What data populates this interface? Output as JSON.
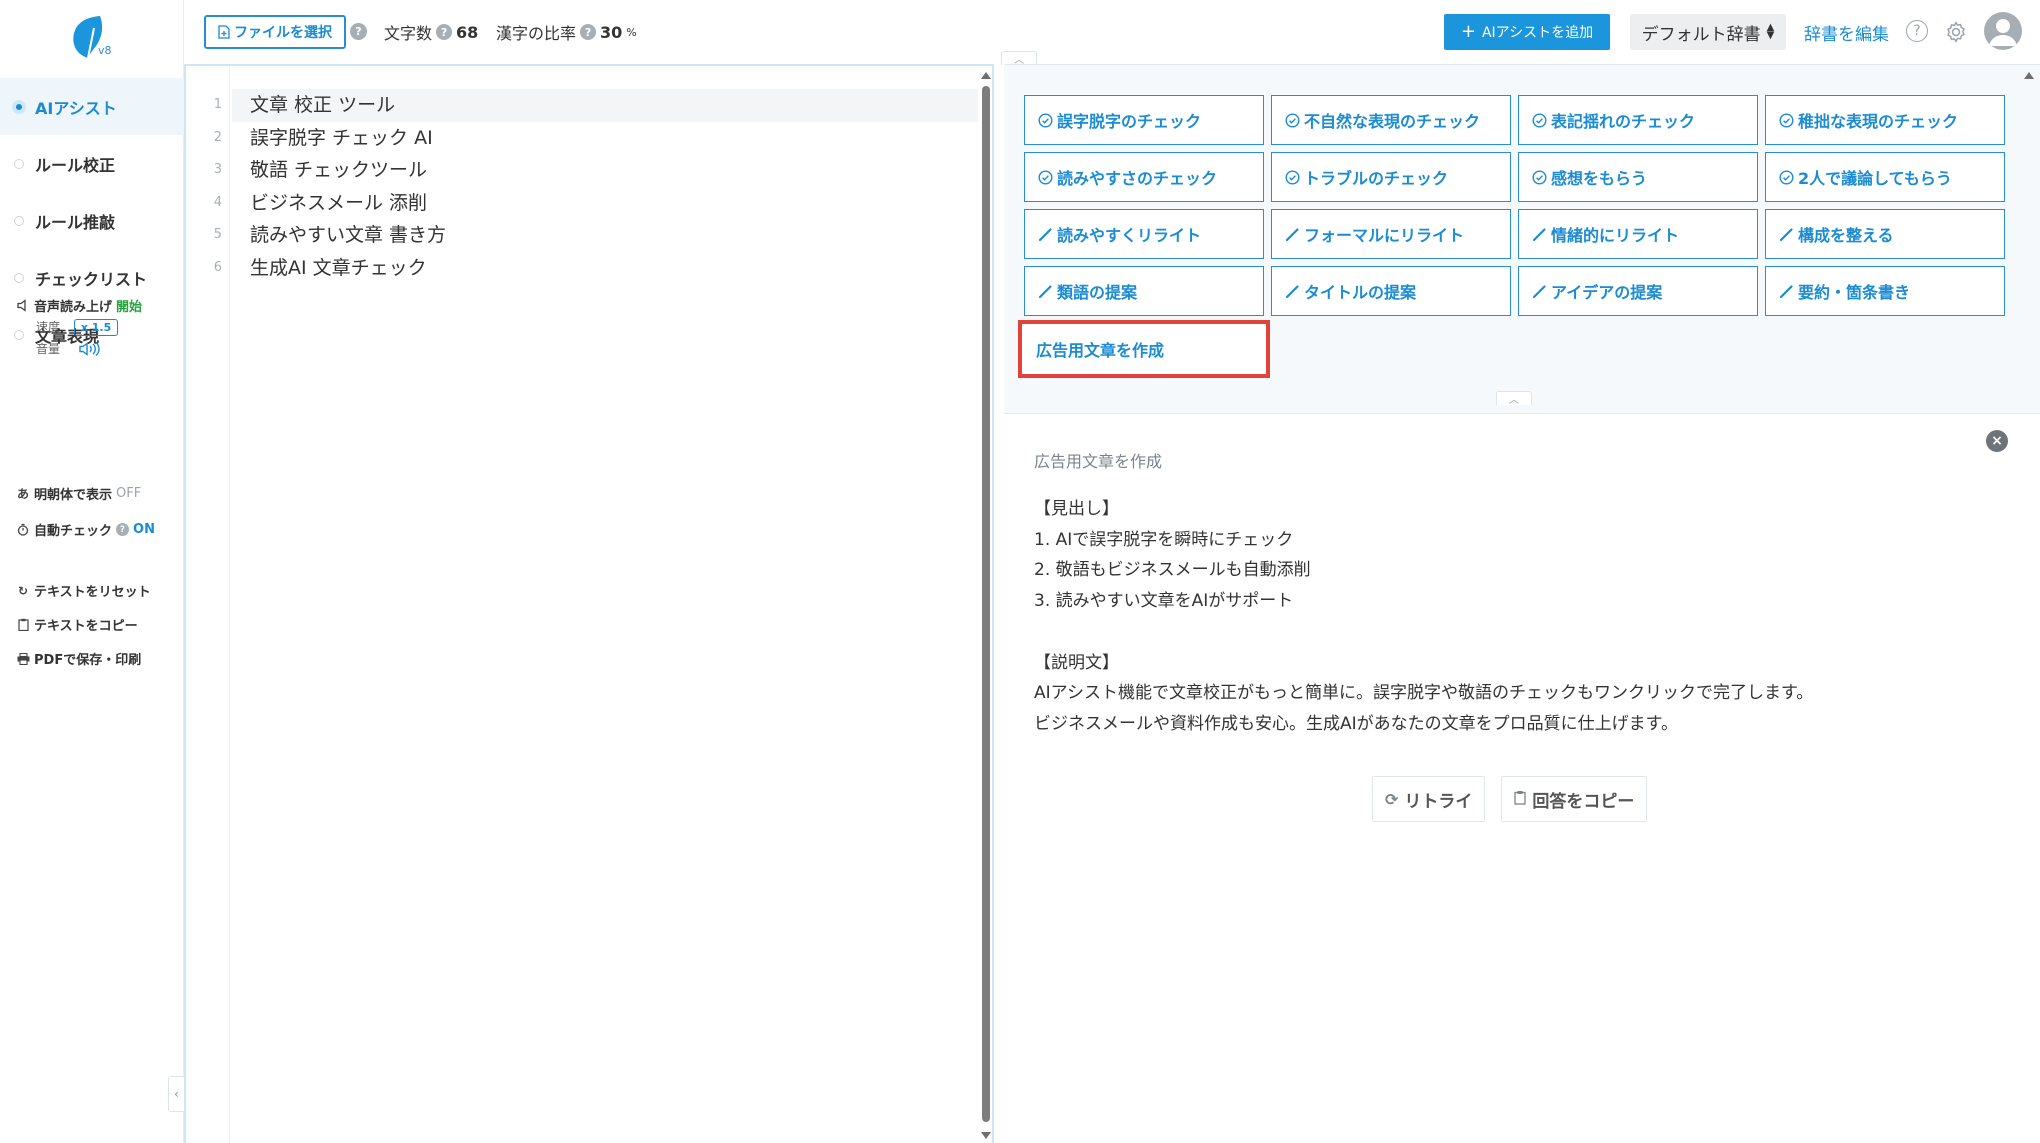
{
  "app": {
    "logo_version": "v8"
  },
  "sidebar": {
    "nav": [
      {
        "label": "AIアシスト",
        "active": true
      },
      {
        "label": "ルール校正",
        "active": false
      },
      {
        "label": "ルール推敲",
        "active": false
      },
      {
        "label": "チェックリスト",
        "active": false
      },
      {
        "label": "文章表現",
        "active": false
      }
    ],
    "voice": {
      "label": "音声読み上げ",
      "action": "開始",
      "speed_label": "速度",
      "speed_value": "x 1.5",
      "volume_label": "音量"
    },
    "mincho": {
      "label": "明朝体で表示",
      "state": "OFF"
    },
    "auto_check": {
      "label": "自動チェック",
      "state": "ON"
    },
    "reset": "テキストをリセット",
    "copy": "テキストをコピー",
    "pdf": "PDFで保存・印刷"
  },
  "topbar": {
    "file_button": "ファイルを選択",
    "char_count_label": "文字数",
    "char_count": "68",
    "kanji_ratio_label": "漢字の比率",
    "kanji_ratio": "30",
    "kanji_ratio_unit": "%",
    "add_ai_button": "AIアシストを追加",
    "dictionary": "デフォルト辞書",
    "edit_dictionary": "辞書を編集"
  },
  "editor": {
    "lines": [
      {
        "num": "1",
        "text": "文章 校正 ツール"
      },
      {
        "num": "2",
        "text": "誤字脱字 チェック AI"
      },
      {
        "num": "3",
        "text": "敬語 チェックツール"
      },
      {
        "num": "4",
        "text": "ビジネスメール 添削"
      },
      {
        "num": "5",
        "text": "読みやすい文章 書き方"
      },
      {
        "num": "6",
        "text": "生成AI 文章チェック"
      }
    ]
  },
  "assist": {
    "buttons": [
      {
        "label": "誤字脱字のチェック",
        "icon": "check-circle"
      },
      {
        "label": "不自然な表現のチェック",
        "icon": "check-circle"
      },
      {
        "label": "表記揺れのチェック",
        "icon": "check-circle"
      },
      {
        "label": "稚拙な表現のチェック",
        "icon": "check-circle"
      },
      {
        "label": "読みやすさのチェック",
        "icon": "check-circle"
      },
      {
        "label": "トラブルのチェック",
        "icon": "check-circle"
      },
      {
        "label": "感想をもらう",
        "icon": "check-circle"
      },
      {
        "label": "2人で議論してもらう",
        "icon": "check-circle"
      },
      {
        "label": "読みやすくリライト",
        "icon": "pencil"
      },
      {
        "label": "フォーマルにリライト",
        "icon": "pencil"
      },
      {
        "label": "情緒的にリライト",
        "icon": "pencil"
      },
      {
        "label": "構成を整える",
        "icon": "pencil"
      },
      {
        "label": "類語の提案",
        "icon": "pencil"
      },
      {
        "label": "タイトルの提案",
        "icon": "pencil"
      },
      {
        "label": "アイデアの提案",
        "icon": "pencil"
      },
      {
        "label": "要約・箇条書き",
        "icon": "pencil"
      },
      {
        "label": "広告用文章を作成",
        "icon": "none",
        "highlighted": true
      }
    ]
  },
  "result": {
    "title": "広告用文章を作成",
    "lines": [
      "【見出し】",
      "1. AIで誤字脱字を瞬時にチェック",
      "2. 敬語もビジネスメールも自動添削",
      "3. 読みやすい文章をAIがサポート",
      "",
      "【説明文】",
      "AIアシスト機能で文章校正がもっと簡単に。誤字脱字や敬語のチェックもワンクリックで完了します。",
      "ビジネスメールや資料作成も安心。生成AIがあなたの文章をプロ品質に仕上げます。"
    ],
    "retry_button": "リトライ",
    "copy_button": "回答をコピー"
  },
  "colors": {
    "accent": "#1b8bd4",
    "highlight_border": "#e0433b",
    "on_green": "#22a33c"
  }
}
